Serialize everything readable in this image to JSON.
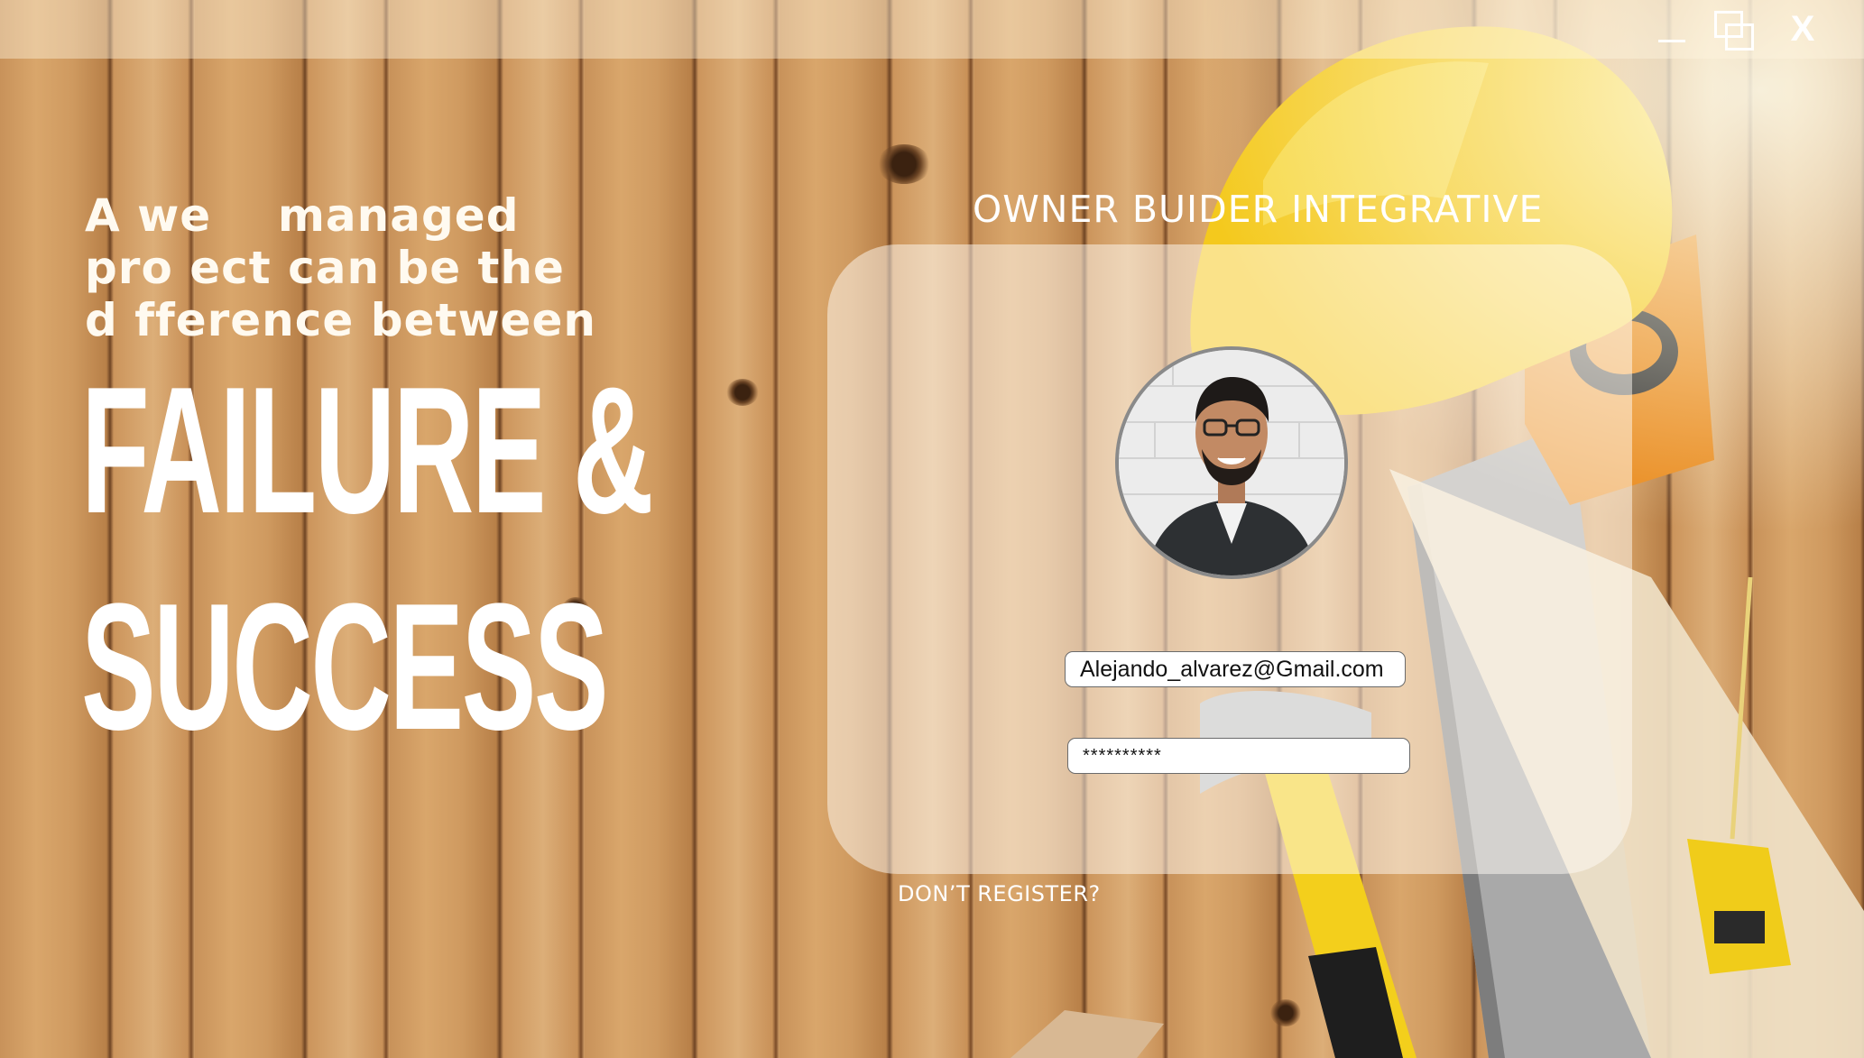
{
  "window": {
    "controls": [
      {
        "icon": "minimize-icon"
      },
      {
        "icon": "maximize-icon"
      },
      {
        "icon": "close-icon",
        "label": "X"
      }
    ]
  },
  "hero": {
    "tagline_lines": [
      "A we    managed",
      "pro ect can be the",
      "d fference between"
    ],
    "headline_lines": [
      "FAILURE &",
      "SUCCESS"
    ]
  },
  "login": {
    "title": "OWNER BUIDER INTEGRATIVE",
    "avatar_icon": "user-avatar-photo",
    "email_value": "Alejando_alvarez@Gmail.com",
    "password_value": "**********",
    "register_link": "DON’T REGISTER?"
  },
  "colors": {
    "wood": "#c8925a",
    "helmet": "#f2c81f",
    "text": "#ffffff",
    "card": "#fffcf5"
  }
}
